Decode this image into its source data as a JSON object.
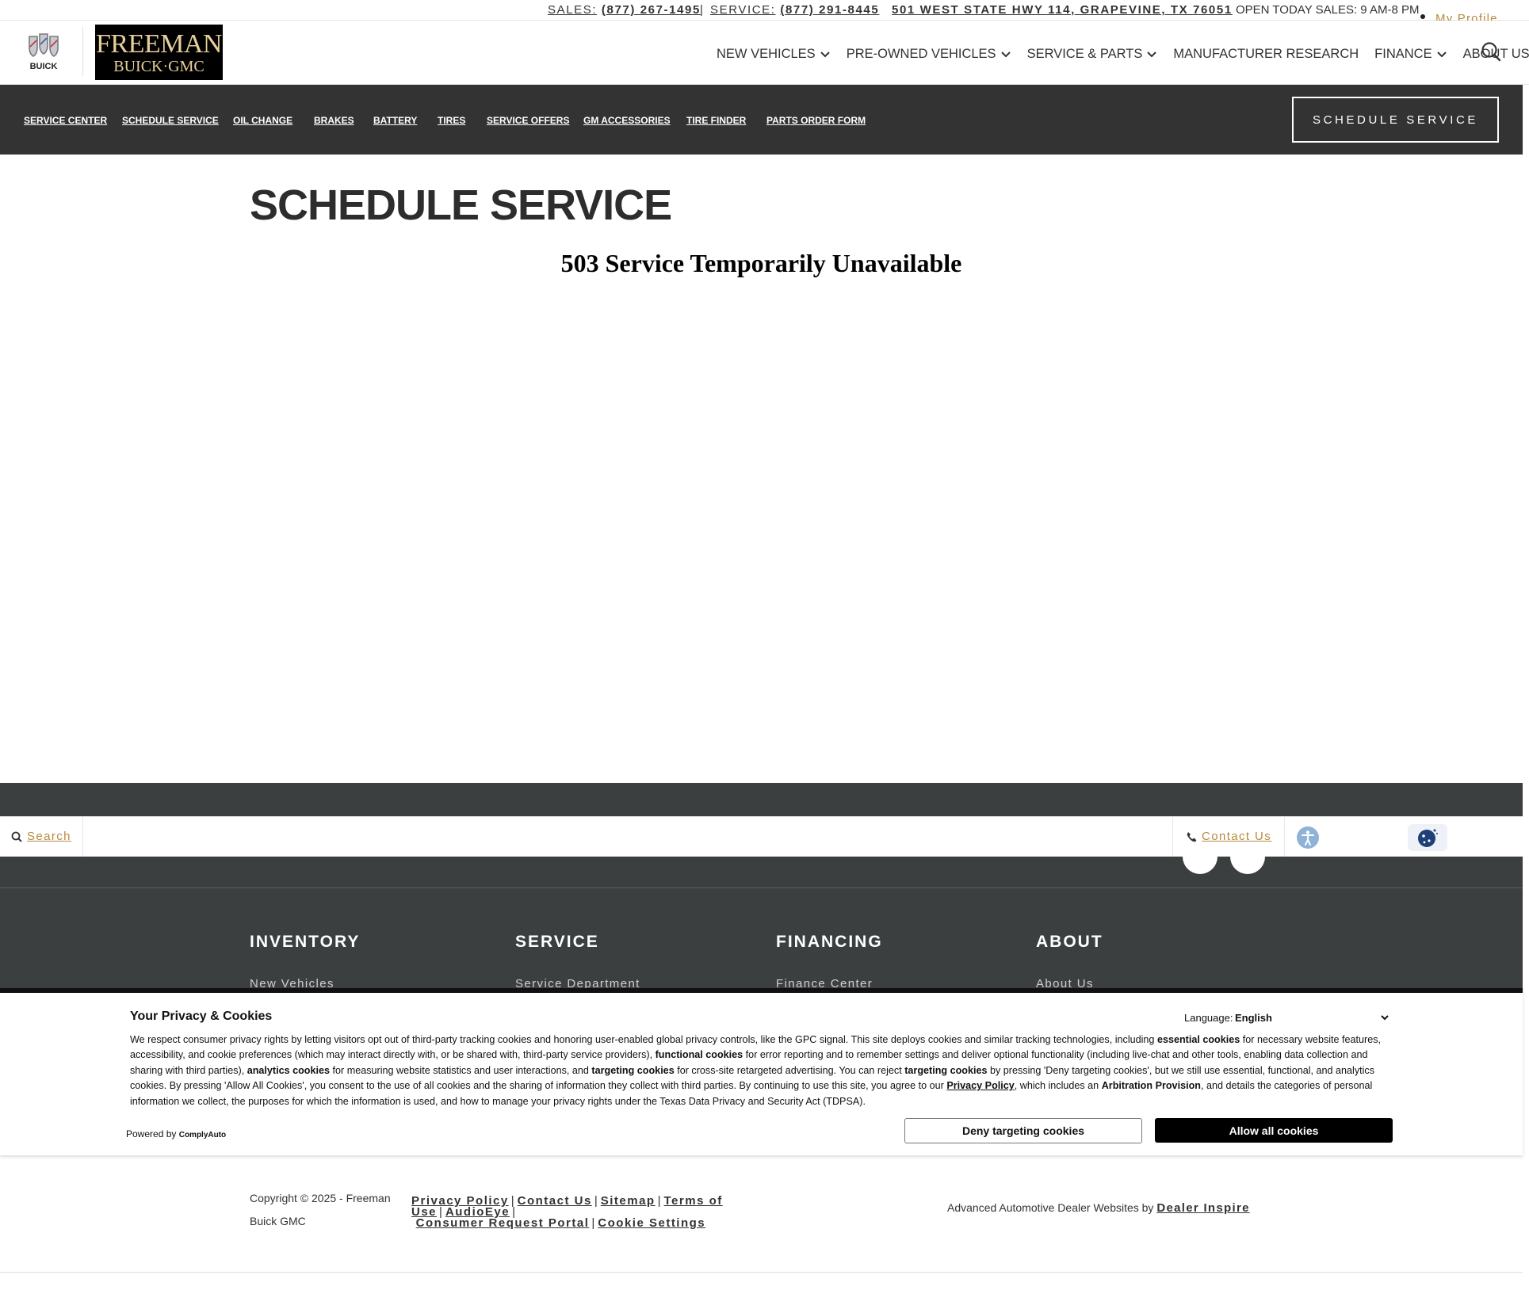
{
  "topbar": {
    "sales_label": "SALES:",
    "sales_phone": "(877) 267-1495",
    "divider": "|",
    "service_label": "SERVICE:",
    "service_phone": "(877) 291-8445",
    "address": "501 WEST STATE HWY 114, GRAPEVINE, TX 76051",
    "hours": "OPEN TODAY SALES: 9 AM-8 PM",
    "profile": "My Profile"
  },
  "header": {
    "brand_small": "BUICK",
    "dealer_logo_line1": "FREEMAN",
    "dealer_logo_line2": "BUICK·GMC",
    "nav": [
      {
        "label": "NEW VEHICLES"
      },
      {
        "label": "PRE-OWNED VEHICLES"
      },
      {
        "label": "SERVICE & PARTS"
      },
      {
        "label": "MANUFACTURER RESEARCH"
      },
      {
        "label": "FINANCE"
      },
      {
        "label": "ABOUT US"
      }
    ]
  },
  "subnav": {
    "links": [
      "SERVICE CENTER",
      "SCHEDULE SERVICE",
      "OIL CHANGE",
      "BRAKES",
      "BATTERY",
      "TIRES",
      "SERVICE OFFERS",
      "GM ACCESSORIES",
      "TIRE FINDER",
      "PARTS ORDER FORM"
    ],
    "cta": "SCHEDULE SERVICE"
  },
  "main": {
    "title": "SCHEDULE SERVICE",
    "error": "503 Service Temporarily Unavailable"
  },
  "quickbar": {
    "search": "Search",
    "contact": "Contact Us"
  },
  "footer": {
    "columns": [
      {
        "heading": "INVENTORY",
        "first_link": "New Vehicles"
      },
      {
        "heading": "SERVICE",
        "first_link": "Service Department"
      },
      {
        "heading": "FINANCING",
        "first_link": "Finance Center"
      },
      {
        "heading": "ABOUT",
        "first_link": "About Us"
      }
    ],
    "copyright": "Copyright © 2025 - Freeman Buick GMC",
    "legal_links": [
      "Privacy Policy",
      "Contact Us",
      "Sitemap",
      "Terms of Use",
      "AudioEye",
      "Consumer Request Portal",
      "Cookie Settings"
    ],
    "credit_text": "Advanced Automotive Dealer Websites by",
    "credit_link": "Dealer Inspire"
  },
  "cookie_banner": {
    "title": "Your Privacy & Cookies",
    "language_label": "Language:",
    "language_value": "English",
    "text_parts": {
      "p1": "We respect consumer privacy rights by letting visitors opt out of third-party tracking cookies and honoring user-enabled global privacy controls, like the GPC signal. This site deploys cookies and similar tracking technologies, including ",
      "b1": "essential cookies",
      "p2": " for necessary website features, accessibility, and cookie preferences (which may interact directly with, or be shared with, third-party service providers), ",
      "b2": "functional cookies",
      "p3": " for error reporting and to remember settings and deliver optional functionality (including live-chat and other tools, enabling data collection and sharing with third parties), ",
      "b3": "analytics cookies",
      "p4": " for measuring website statistics and user interactions, and ",
      "b4": "targeting cookies",
      "p5": " for cross-site retargeted advertising. You can reject ",
      "b5": "targeting cookies",
      "p6": " by pressing 'Deny targeting cookies', but we still use essential, functional, and analytics cookies. By pressing 'Allow All Cookies', you consent to the use of all cookies and the sharing of information they collect with third parties. By continuing to use this site, you agree to our ",
      "link": "Privacy Policy",
      "p7": ", which includes an ",
      "b6": "Arbitration Provision",
      "p8": ", and details the categories of personal information we collect, the purposes for which the information is used, and how to manage your privacy rights under the Texas Data Privacy and Security Act (TDPSA)."
    },
    "powered_by": "Powered by",
    "powered_brand": "ComplyAuto",
    "deny": "Deny targeting cookies",
    "allow": "Allow all cookies"
  },
  "colors": {
    "dark_band": "#333333",
    "footer_bg": "#3c3f40",
    "accent_gold": "#b78a3e",
    "logo_gold": "#e6cf9a"
  }
}
